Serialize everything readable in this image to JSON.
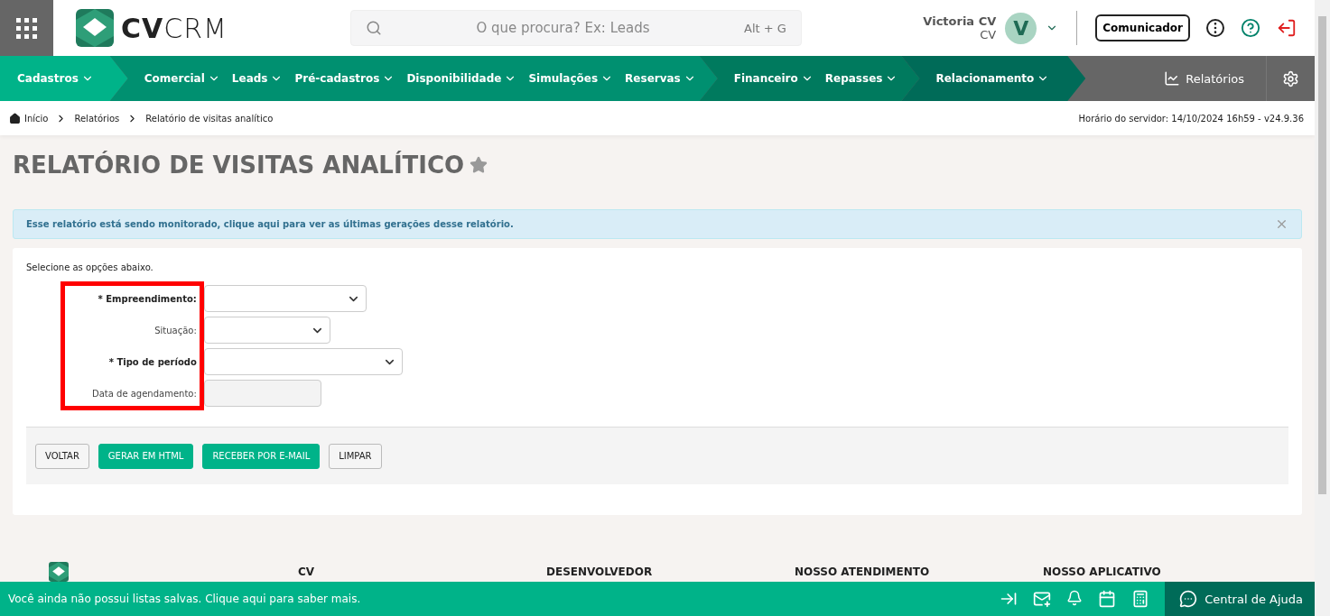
{
  "header": {
    "logo_text": {
      "bold": "CV",
      "light": "CRM"
    },
    "search": {
      "placeholder": "O que procura? Ex: Leads",
      "shortcut": "Alt + G"
    },
    "user": {
      "name": "Victoria CV",
      "role": "CV",
      "initial": "V"
    },
    "communicator_button": "Comunicador"
  },
  "nav": {
    "groups": [
      {
        "items": [
          "Cadastros"
        ]
      },
      {
        "items": [
          "Comercial",
          "Leads",
          "Pré-cadastros",
          "Disponibilidade",
          "Simulações",
          "Reservas"
        ]
      },
      {
        "items": [
          "Financeiro",
          "Repasses"
        ]
      },
      {
        "items": [
          "Relacionamento"
        ]
      }
    ],
    "reports": "Relatórios"
  },
  "breadcrumb": [
    "Início",
    "Relatórios",
    "Relatório de visitas analítico"
  ],
  "server_time": "Horário do servidor: 14/10/2024 16h59 - v24.9.36",
  "page_title": "RELATÓRIO DE VISITAS ANALÍTICO",
  "favorite": false,
  "alert": "Esse relatório está sendo monitorado, clique aqui para ver as últimas gerações desse relatório.",
  "form": {
    "intro": "Selecione as opções abaixo.",
    "labels_highlighted": true,
    "fields": [
      {
        "label": "* Empreendimento:",
        "required": true,
        "kind": "select",
        "disabled": false
      },
      {
        "label": "Situação:",
        "required": false,
        "kind": "select",
        "disabled": false
      },
      {
        "label": "* Tipo de período",
        "required": true,
        "kind": "select",
        "disabled": false
      },
      {
        "label": "Data de agendamento:",
        "required": false,
        "kind": "input",
        "disabled": true
      }
    ],
    "buttons": [
      {
        "label": "VOLTAR",
        "primary": false
      },
      {
        "label": "GERAR EM HTML",
        "primary": true
      },
      {
        "label": "RECEBER POR E-MAIL",
        "primary": true
      },
      {
        "label": "LIMPAR",
        "primary": false
      }
    ]
  },
  "footer": {
    "headings": [
      "CV",
      "DESENVOLVEDOR",
      "NOSSO ATENDIMENTO",
      "NOSSO APLICATIVO"
    ]
  },
  "bottom_bar": {
    "message": "Você ainda não possui listas salvas. Clique aqui para saber mais.",
    "help": "Central de Ajuda"
  }
}
